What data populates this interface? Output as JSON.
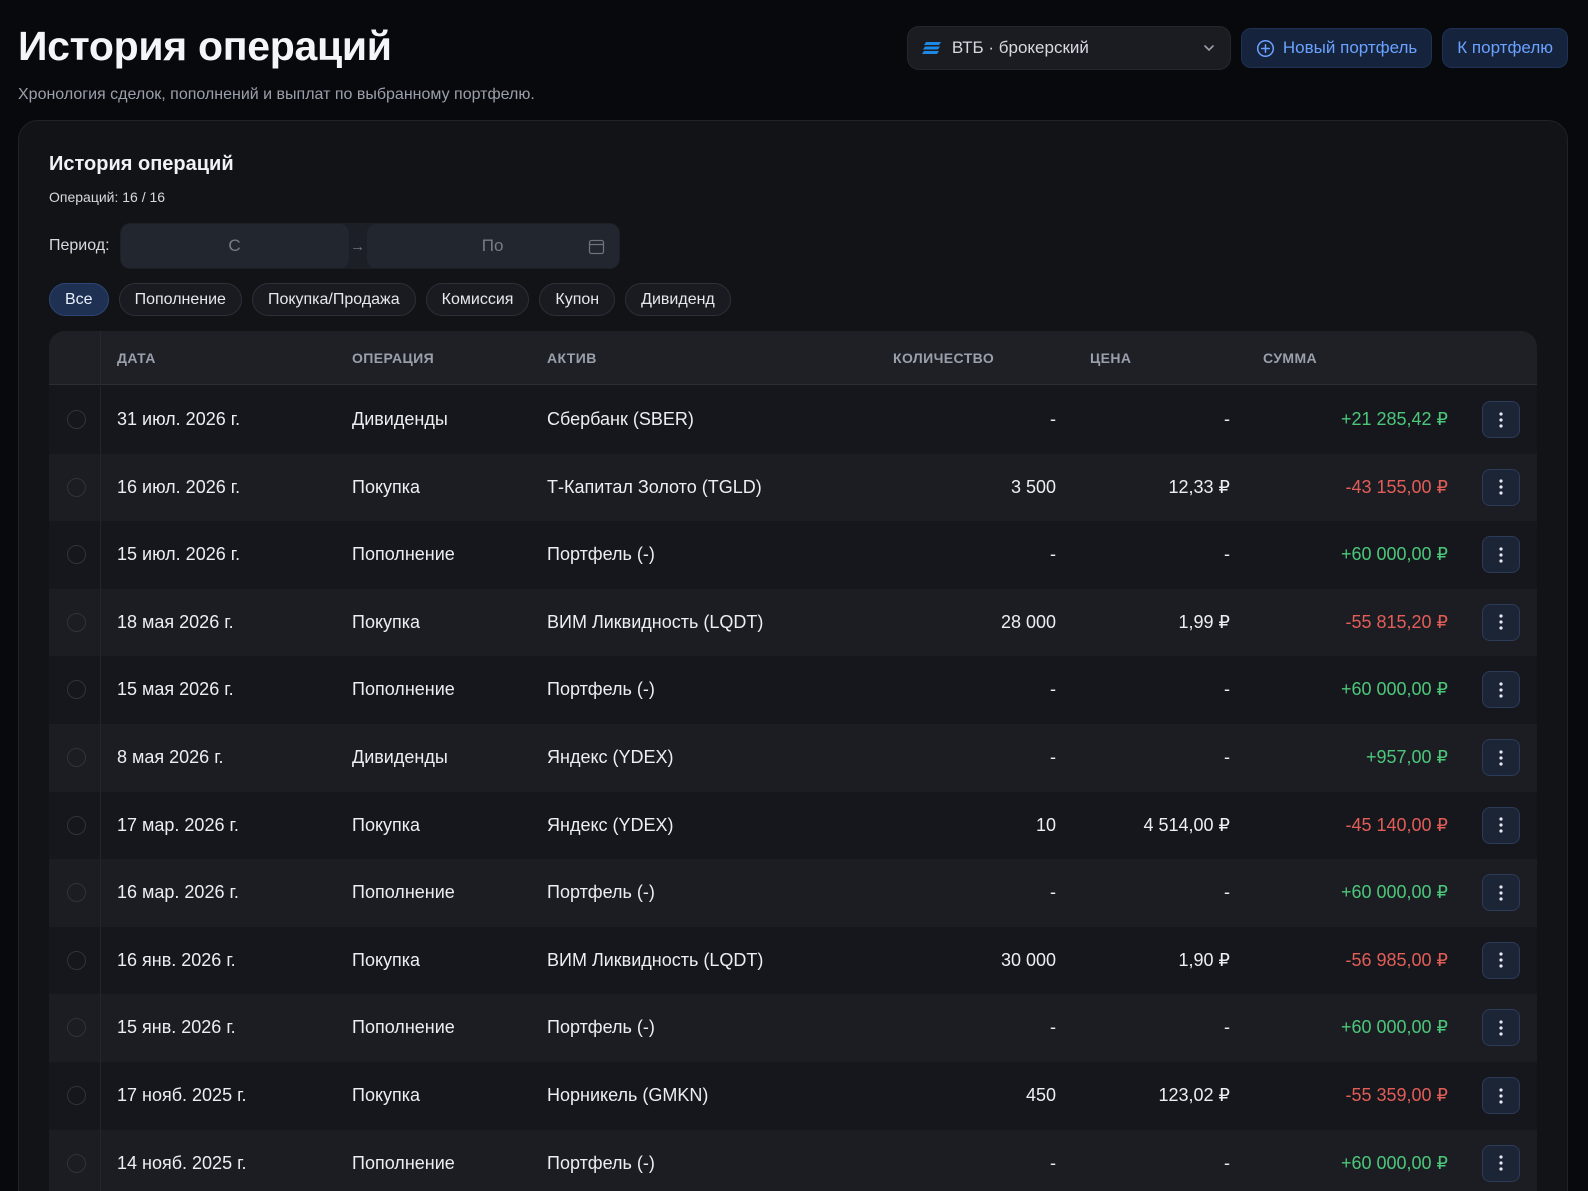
{
  "header": {
    "title": "История операций",
    "subtitle": "Хронология сделок, пополнений и выплат по выбранному портфелю.",
    "portfolio_select": "ВТБ · брокерский",
    "new_portfolio": "Новый портфель",
    "to_portfolio": "К портфелю"
  },
  "card": {
    "title": "История операций",
    "count": "Операций: 16 / 16",
    "period_label": "Период:",
    "period_from_placeholder": "С",
    "period_to_placeholder": "По"
  },
  "filters": [
    "Все",
    "Пополнение",
    "Покупка/Продажа",
    "Комиссия",
    "Купон",
    "Дивиденд"
  ],
  "active_filter": "Все",
  "columns": {
    "date": "ДАТА",
    "operation": "ОПЕРАЦИЯ",
    "asset": "АКТИВ",
    "quantity": "КОЛИЧЕСТВО",
    "price": "ЦЕНА",
    "sum": "СУММА"
  },
  "colors": {
    "accent": "#6aa2ff",
    "positive": "#4cc77a",
    "negative": "#e25d57"
  },
  "rows": [
    {
      "date": "31 июл. 2026 г.",
      "operation": "Дивиденды",
      "asset": "Сбербанк (SBER)",
      "quantity": "-",
      "price": "-",
      "sum": "+21 285,42 ₽",
      "sign": "pos"
    },
    {
      "date": "16 июл. 2026 г.",
      "operation": "Покупка",
      "asset": "Т-Капитал Золото (TGLD)",
      "quantity": "3 500",
      "price": "12,33 ₽",
      "sum": "-43 155,00 ₽",
      "sign": "neg"
    },
    {
      "date": "15 июл. 2026 г.",
      "operation": "Пополнение",
      "asset": "Портфель (-)",
      "quantity": "-",
      "price": "-",
      "sum": "+60 000,00 ₽",
      "sign": "pos"
    },
    {
      "date": "18 мая 2026 г.",
      "operation": "Покупка",
      "asset": "ВИМ Ликвидность (LQDT)",
      "quantity": "28 000",
      "price": "1,99 ₽",
      "sum": "-55 815,20 ₽",
      "sign": "neg"
    },
    {
      "date": "15 мая 2026 г.",
      "operation": "Пополнение",
      "asset": "Портфель (-)",
      "quantity": "-",
      "price": "-",
      "sum": "+60 000,00 ₽",
      "sign": "pos"
    },
    {
      "date": "8 мая 2026 г.",
      "operation": "Дивиденды",
      "asset": "Яндекс (YDEX)",
      "quantity": "-",
      "price": "-",
      "sum": "+957,00 ₽",
      "sign": "pos"
    },
    {
      "date": "17 мар. 2026 г.",
      "operation": "Покупка",
      "asset": "Яндекс (YDEX)",
      "quantity": "10",
      "price": "4 514,00 ₽",
      "sum": "-45 140,00 ₽",
      "sign": "neg"
    },
    {
      "date": "16 мар. 2026 г.",
      "operation": "Пополнение",
      "asset": "Портфель (-)",
      "quantity": "-",
      "price": "-",
      "sum": "+60 000,00 ₽",
      "sign": "pos"
    },
    {
      "date": "16 янв. 2026 г.",
      "operation": "Покупка",
      "asset": "ВИМ Ликвидность (LQDT)",
      "quantity": "30 000",
      "price": "1,90 ₽",
      "sum": "-56 985,00 ₽",
      "sign": "neg"
    },
    {
      "date": "15 янв. 2026 г.",
      "operation": "Пополнение",
      "asset": "Портфель (-)",
      "quantity": "-",
      "price": "-",
      "sum": "+60 000,00 ₽",
      "sign": "pos"
    },
    {
      "date": "17 нояб. 2025 г.",
      "operation": "Покупка",
      "asset": "Норникель (GMKN)",
      "quantity": "450",
      "price": "123,02 ₽",
      "sum": "-55 359,00 ₽",
      "sign": "neg"
    },
    {
      "date": "14 нояб. 2025 г.",
      "operation": "Пополнение",
      "asset": "Портфель (-)",
      "quantity": "-",
      "price": "-",
      "sum": "+60 000,00 ₽",
      "sign": "pos"
    }
  ]
}
